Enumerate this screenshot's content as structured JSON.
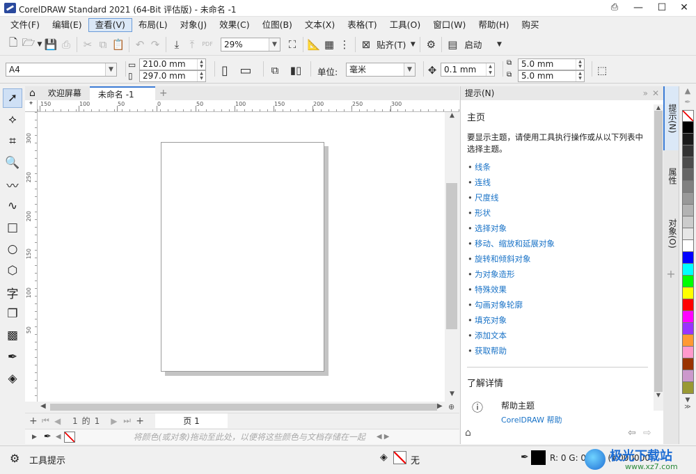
{
  "window": {
    "title": "CorelDRAW Standard 2021 (64-Bit 评估版) - 未命名 -1"
  },
  "menu": [
    "文件(F)",
    "编辑(E)",
    "查看(V)",
    "布局(L)",
    "对象(J)",
    "效果(C)",
    "位图(B)",
    "文本(X)",
    "表格(T)",
    "工具(O)",
    "窗口(W)",
    "帮助(H)",
    "购买"
  ],
  "menu_active": "查看(V)",
  "toolbar": {
    "zoom": "29%",
    "snap_label": "贴齐(T)",
    "launch_label": "启动",
    "pdf_label": "PDF"
  },
  "propbar": {
    "paper": "A4",
    "width": "210.0 mm",
    "height": "297.0 mm",
    "unit_label": "单位:",
    "unit": "毫米",
    "nudge": "0.1 mm",
    "dup_x": "5.0 mm",
    "dup_y": "5.0 mm"
  },
  "tabs": {
    "welcome": "欢迎屏幕",
    "doc": "未命名 -1",
    "add": "+"
  },
  "ruler_h": [
    "150",
    "100",
    "50",
    "0",
    "50",
    "100",
    "150",
    "200",
    "250",
    "300"
  ],
  "ruler_v": [
    "300",
    "250",
    "200",
    "150",
    "100",
    "50"
  ],
  "pagebar": {
    "current": "1",
    "of": "的",
    "total": "1",
    "page_tab": "页 1"
  },
  "color_hint": "将颜色(或对象)拖动至此处，以便将这些颜色与文档存储在一起",
  "docker": {
    "header": "提示(N)",
    "heading": "主页",
    "intro": "要显示主题，请使用工具执行操作或从以下列表中选择主题。",
    "links": [
      "线条",
      "连线",
      "尺度线",
      "形状",
      "选择对象",
      "移动、缩放和延展对象",
      "旋转和倾斜对象",
      "为对象造形",
      "特殊效果",
      "勾画对象轮廓",
      "填充对象",
      "添加文本",
      "获取帮助"
    ],
    "learn_more": "了解详情",
    "help_topics": "帮助主题",
    "help_link": "CorelDRAW 帮助"
  },
  "docker_tabs": [
    "提示(N)",
    "属性",
    "对象(O)"
  ],
  "palette_colors": [
    "#000000",
    "#1a1a1a",
    "#333333",
    "#4d4d4d",
    "#666666",
    "#808080",
    "#999999",
    "#b3b3b3",
    "#cccccc",
    "#e6e6e6",
    "#ffffff",
    "#0000ff",
    "#00ffff",
    "#00ff00",
    "#ffff00",
    "#ff0000",
    "#ff00ff",
    "#9933ff",
    "#ff9933",
    "#ff99cc",
    "#993300",
    "#cc99cc",
    "#999933"
  ],
  "status": {
    "tool_hint": "工具提示",
    "fill_label": "无",
    "color_readout": "R: 0 G: 0 B: 0 (#000000)",
    "watermark": "极光下载站",
    "watermark_url": "www.xz7.com"
  }
}
